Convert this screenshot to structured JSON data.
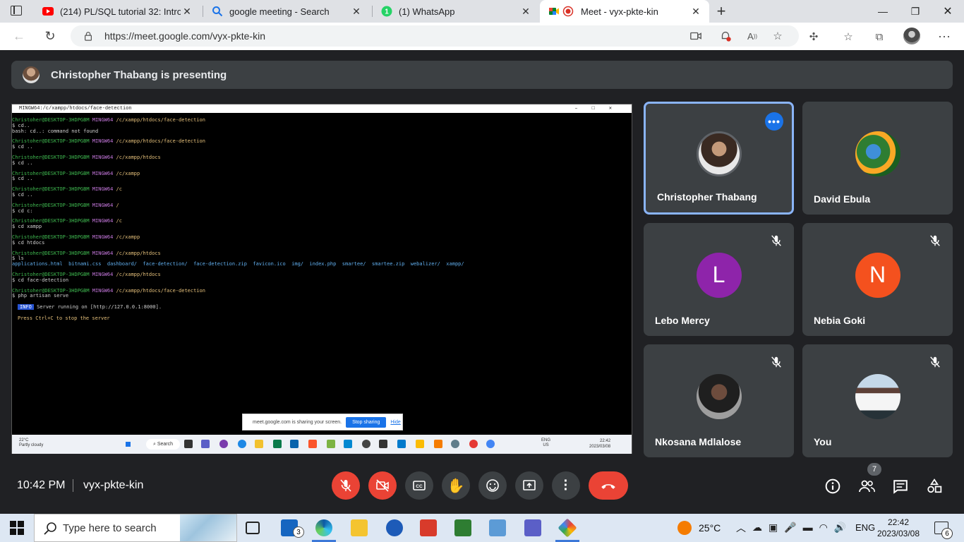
{
  "browser": {
    "tabs": [
      {
        "title": "(214) PL/SQL tutorial 32: Introduc",
        "icon": "youtube-icon"
      },
      {
        "title": "google meeting - Search",
        "icon": "search-icon"
      },
      {
        "title": "(1) WhatsApp",
        "icon": "whatsapp-icon"
      },
      {
        "title": "Meet - vyx-pkte-kin",
        "icon": "meet-icon",
        "active": true
      }
    ],
    "url": "https://meet.google.com/vyx-pkte-kin"
  },
  "meet": {
    "banner_text": "Christopher Thabang is presenting",
    "time": "10:42 PM",
    "meeting_code": "vyx-pkte-kin",
    "people_count": "7",
    "participants": [
      {
        "name": "Christopher Thabang",
        "avatar": "photo",
        "muted": false,
        "speaking": true
      },
      {
        "name": "David Ebula",
        "avatar": "parrot-photo",
        "muted": false
      },
      {
        "name": "Lebo Mercy",
        "initial": "L",
        "color": "#8e24aa",
        "muted": true
      },
      {
        "name": "Nebia Goki",
        "initial": "N",
        "color": "#f4511e",
        "muted": true
      },
      {
        "name": "Nkosana Mdlalose",
        "avatar": "photo",
        "muted": true
      },
      {
        "name": "You",
        "avatar": "photo",
        "muted": true
      }
    ]
  },
  "shared_screen": {
    "window_title": "MINGW64:/c/xampp/htdocs/face-detection",
    "lines": [
      {
        "user": "Christoher@DESKTOP-3HDPGBM",
        "env": "MINGW64",
        "path": "/c/xampp/htdocs/face-detection"
      },
      {
        "cmd": "$ cd.."
      },
      {
        "out": "bash: cd..: command not found"
      },
      {
        "user": "Christoher@DESKTOP-3HDPGBM",
        "env": "MINGW64",
        "path": "/c/xampp/htdocs/face-detection"
      },
      {
        "cmd": "$ cd .."
      },
      {
        "user": "Christoher@DESKTOP-3HDPGBM",
        "env": "MINGW64",
        "path": "/c/xampp/htdocs"
      },
      {
        "cmd": "$ cd .."
      },
      {
        "user": "Christoher@DESKTOP-3HDPGBM",
        "env": "MINGW64",
        "path": "/c/xampp"
      },
      {
        "cmd": "$ cd .."
      },
      {
        "user": "Christoher@DESKTOP-3HDPGBM",
        "env": "MINGW64",
        "path": "/c"
      },
      {
        "cmd": "$ cd .."
      },
      {
        "user": "Christoher@DESKTOP-3HDPGBM",
        "env": "MINGW64",
        "path": "/"
      },
      {
        "cmd": "$ cd c:"
      },
      {
        "user": "Christoher@DESKTOP-3HDPGBM",
        "env": "MINGW64",
        "path": "/c"
      },
      {
        "cmd": "$ cd xampp"
      },
      {
        "user": "Christoher@DESKTOP-3HDPGBM",
        "env": "MINGW64",
        "path": "/c/xampp"
      },
      {
        "cmd": "$ cd htdocs"
      },
      {
        "user": "Christoher@DESKTOP-3HDPGBM",
        "env": "MINGW64",
        "path": "/c/xampp/htdocs"
      },
      {
        "cmd": "$ ls"
      },
      {
        "ls": "applications.html  bitnami.css  dashboard/  face-detection/  face-detection.zip  favicon.ico  img/  index.php  smartee/  smartee.zip  webalizer/  xampp/"
      },
      {
        "user": "Christoher@DESKTOP-3HDPGBM",
        "env": "MINGW64",
        "path": "/c/xampp/htdocs"
      },
      {
        "cmd": "$ cd face-detection"
      },
      {
        "user": "Christoher@DESKTOP-3HDPGBM",
        "env": "MINGW64",
        "path": "/c/xampp/htdocs/face-detection"
      },
      {
        "cmd": "$ php artisan serve"
      }
    ],
    "info_label": "INFO",
    "info_text": "Server running on [http://127.0.0.1:8000].",
    "hint_text": "Press Ctrl+C to stop the server",
    "share_notice": "meet.google.com is sharing your screen.",
    "stop_sharing": "Stop sharing",
    "hide": "Hide",
    "weather_temp": "22°C",
    "weather_desc": "Partly cloudy",
    "search_label": "Search",
    "lang_top": "ENG",
    "lang_bottom": "US",
    "clock_time": "22:42",
    "clock_date": "2023/03/08"
  },
  "taskbar": {
    "search_placeholder": "Type here to search",
    "mail_badge": "3",
    "temperature": "25°C",
    "lang": "ENG",
    "time": "22:42",
    "date": "2023/03/08",
    "notification_count": "6"
  }
}
